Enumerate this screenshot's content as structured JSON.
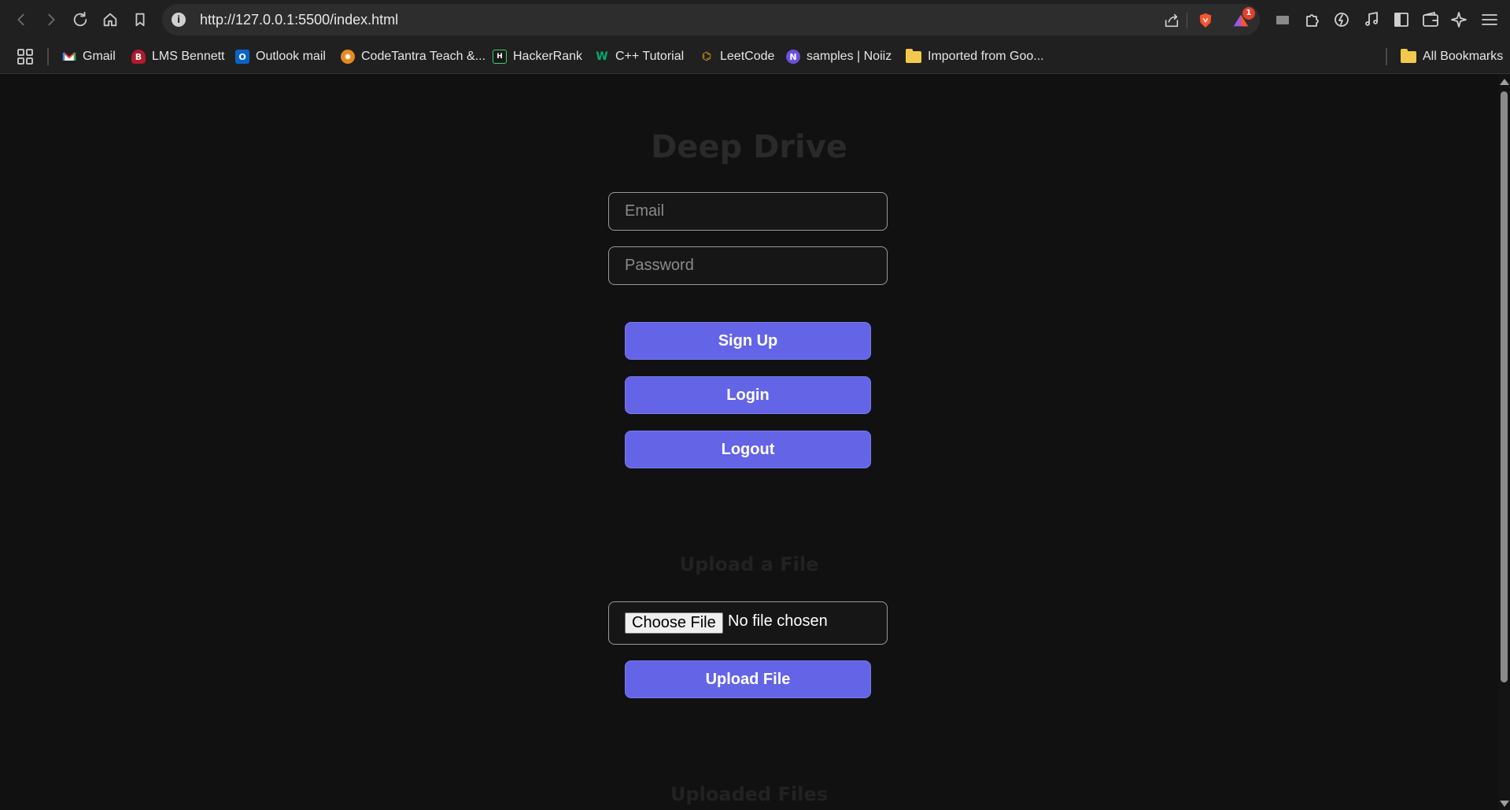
{
  "browser": {
    "url": "http://127.0.0.1:5500/index.html",
    "notification_count": "1",
    "bookmarks": [
      {
        "label": "Gmail",
        "icon": "gmail-icon"
      },
      {
        "label": "LMS Bennett",
        "icon": "lms-icon"
      },
      {
        "label": "Outlook mail",
        "icon": "outlook-icon"
      },
      {
        "label": "CodeTantra Teach &...",
        "icon": "codetantra-icon"
      },
      {
        "label": "HackerRank",
        "icon": "hackerrank-icon"
      },
      {
        "label": "C++ Tutorial",
        "icon": "w3schools-icon"
      },
      {
        "label": "LeetCode",
        "icon": "leetcode-icon"
      },
      {
        "label": "samples | Noiiz",
        "icon": "noiiz-icon"
      },
      {
        "label": "Imported from Goo...",
        "icon": "folder-icon"
      }
    ],
    "all_bookmarks": "All Bookmarks"
  },
  "app": {
    "title": "Deep Drive",
    "email_placeholder": "Email",
    "password_placeholder": "Password",
    "signup_label": "Sign Up",
    "login_label": "Login",
    "logout_label": "Logout",
    "upload_heading": "Upload a File",
    "choose_file_label": "Choose File",
    "no_file_text": "No file chosen",
    "upload_button_label": "Upload File",
    "uploaded_heading": "Uploaded Files"
  }
}
